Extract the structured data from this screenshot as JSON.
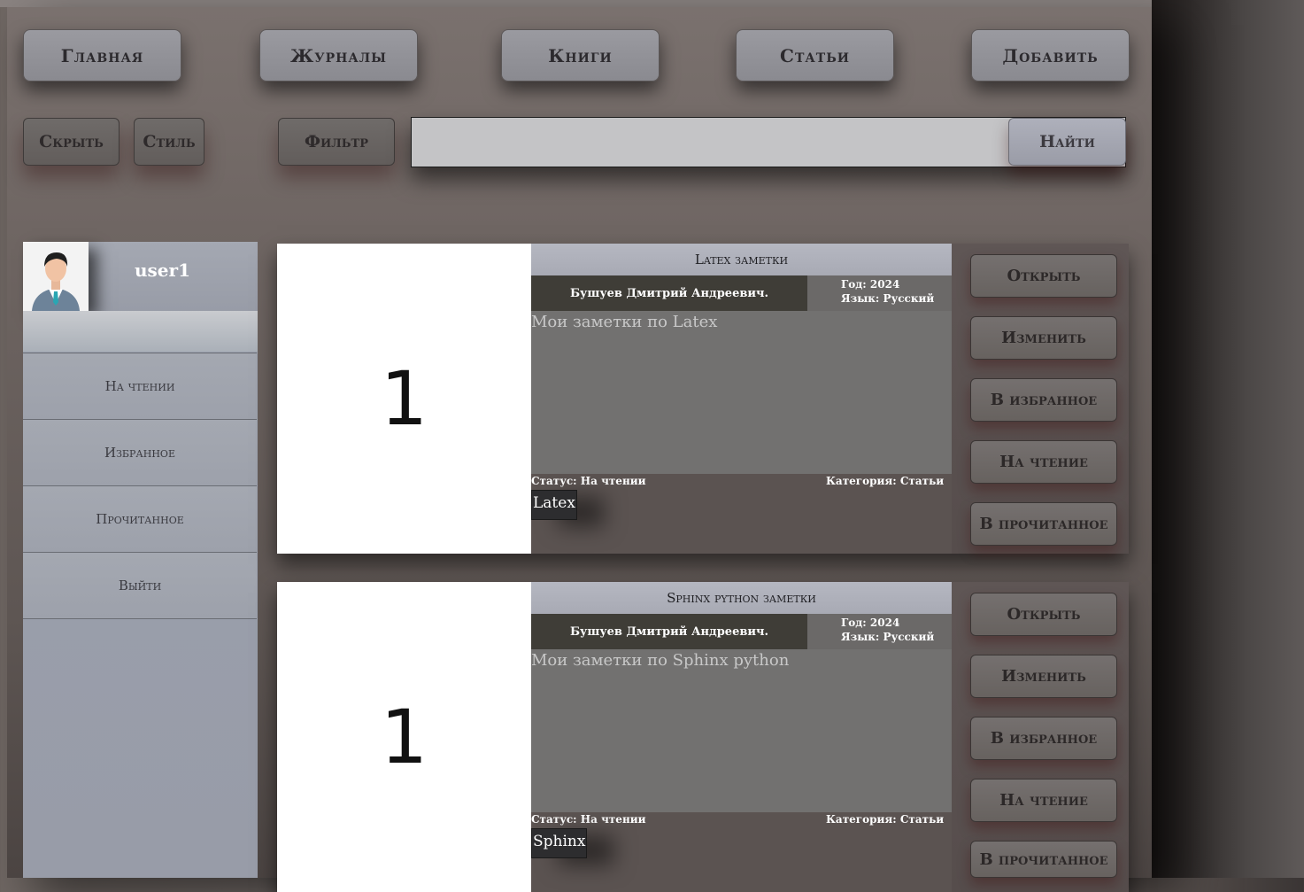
{
  "nav": {
    "home": "Главная",
    "journals": "Журналы",
    "books": "Книги",
    "articles": "Статьи",
    "add": "Добавить"
  },
  "toolbar": {
    "hide": "Скрыть",
    "style": "Стиль",
    "filter": "Фильтр",
    "search_value": "",
    "find": "Найти"
  },
  "sidebar": {
    "avatar_icon": "user-avatar-icon",
    "username": "user1",
    "items": [
      {
        "label": "На чтении"
      },
      {
        "label": "Избранное"
      },
      {
        "label": "Прочитанное"
      },
      {
        "label": "Выйти"
      }
    ]
  },
  "cards": [
    {
      "cover": "1",
      "title": "Latex заметки",
      "author": "Бушуев Дмитрий Андреевич.",
      "year": "Год: 2024",
      "language": "Язык: Русский",
      "description": "Мои заметки по Latex",
      "status": "Статус: На чтении",
      "category": "Категория: Статьи",
      "tag": "Latex",
      "actions": [
        "Открыть",
        "Изменить",
        "В избранное",
        "На чтение",
        "В прочитанное"
      ]
    },
    {
      "cover": "1",
      "title": "Sphinx python заметки",
      "author": "Бушуев Дмитрий Андреевич.",
      "year": "Год: 2024",
      "language": "Язык: Русский",
      "description": "Мои заметки по Sphinx python",
      "status": "Статус: На чтении",
      "category": "Категория: Статьи",
      "tag": "Sphinx",
      "actions": [
        "Открыть",
        "Изменить",
        "В избранное",
        "На чтение",
        "В прочитанное"
      ]
    }
  ]
}
